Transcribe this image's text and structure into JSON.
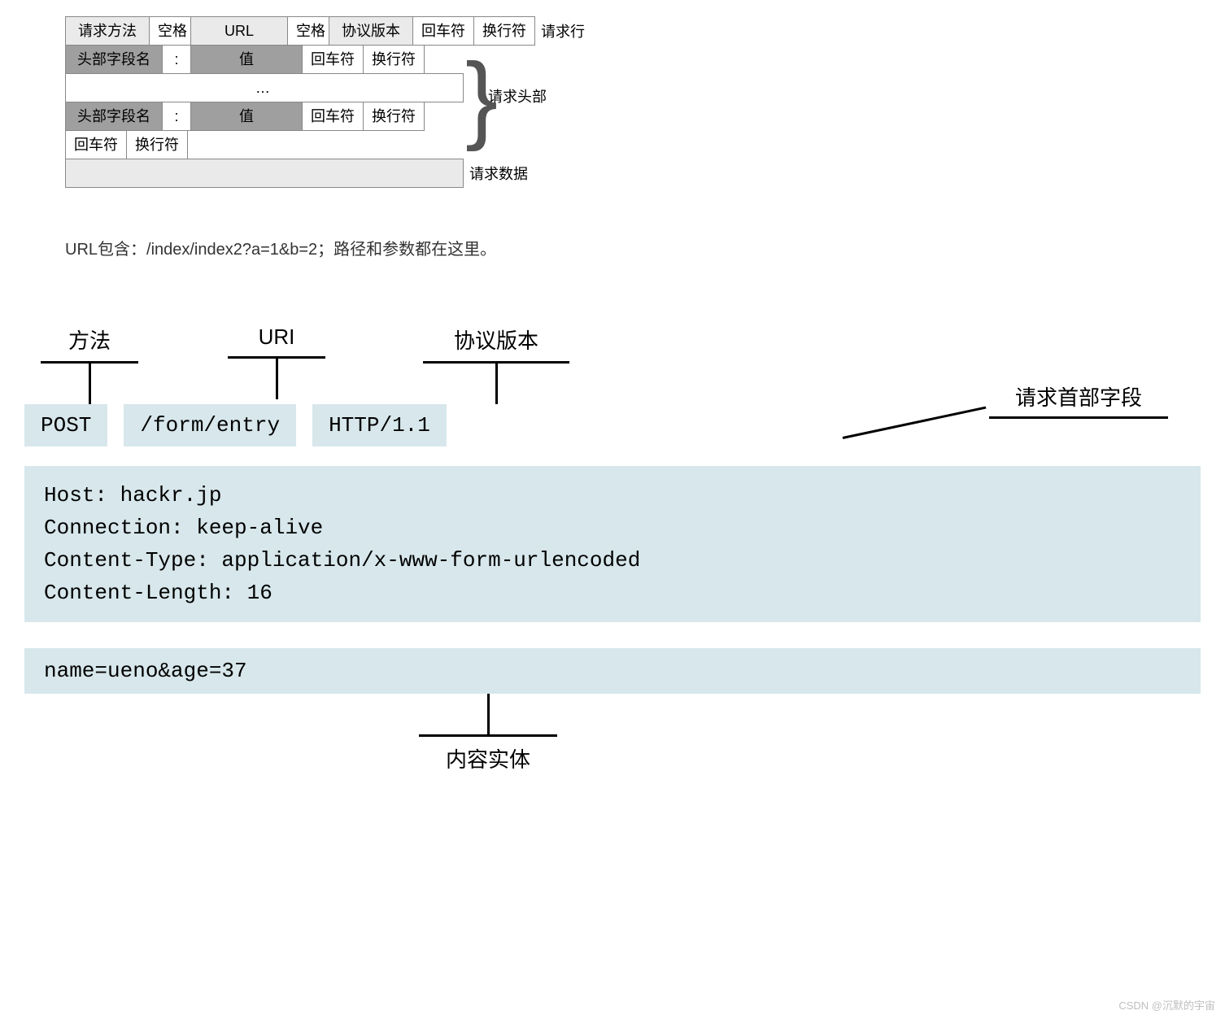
{
  "top": {
    "row1": [
      "请求方法",
      "空格",
      "URL",
      "空格",
      "协议版本",
      "回车符",
      "换行符"
    ],
    "row1_label": "请求行",
    "header_row": [
      "头部字段名",
      ":",
      "值",
      "回车符",
      "换行符"
    ],
    "dots": "…",
    "brace_label": "请求头部",
    "crlf_row": [
      "回车符",
      "换行符"
    ],
    "body_label": "请求数据"
  },
  "note": "URL包含：/index/index2?a=1&b=2；路径和参数都在这里。",
  "bot": {
    "top_labels": [
      "方法",
      "URI",
      "协议版本"
    ],
    "chips": [
      "POST",
      "/form/entry",
      "HTTP/1.1"
    ],
    "headers": "Host: hackr.jp\nConnection: keep-alive\nContent-Type: application/x-www-form-urlencoded\nContent-Length: 16",
    "body": "name=ueno&age=37",
    "callout": "请求首部字段",
    "entity": "内容实体"
  },
  "watermark": "CSDN @沉默的宇宙"
}
